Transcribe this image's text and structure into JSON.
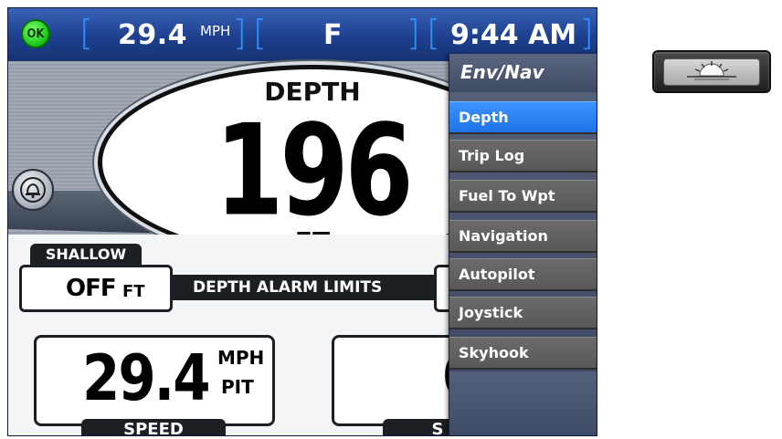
{
  "topbar": {
    "status_badge": "OK",
    "speed_value": "29.4",
    "speed_unit": "MPH",
    "fuel_value": "F",
    "clock": "9:44 AM"
  },
  "depth": {
    "label": "DEPTH",
    "value": "196",
    "unit": "FT"
  },
  "alarm": {
    "shallow_label": "SHALLOW",
    "shallow_value": "OFF",
    "shallow_unit": "FT",
    "limits_label": "DEPTH ALARM LIMITS"
  },
  "speed_gauge": {
    "value": "29.4",
    "unit": "MPH",
    "source": "PIT",
    "label": "SPEED"
  },
  "second_gauge": {
    "value_fragment": "0",
    "label_fragment": "S"
  },
  "menu": {
    "title": "Env/Nav",
    "items": [
      {
        "label": "Depth",
        "selected": true
      },
      {
        "label": "Trip Log",
        "selected": false
      },
      {
        "label": "Fuel To Wpt",
        "selected": false
      },
      {
        "label": "Navigation",
        "selected": false
      },
      {
        "label": "Autopilot",
        "selected": false
      },
      {
        "label": "Joystick",
        "selected": false
      },
      {
        "label": "Skyhook",
        "selected": false
      }
    ]
  },
  "hardware_key": {
    "icon": "brightness-sun-icon"
  },
  "colors": {
    "topbar_blue": "#1d3f8e",
    "bracket_blue": "#2e8fff",
    "ok_green": "#16c416",
    "menu_selected": "#1f74e6"
  }
}
